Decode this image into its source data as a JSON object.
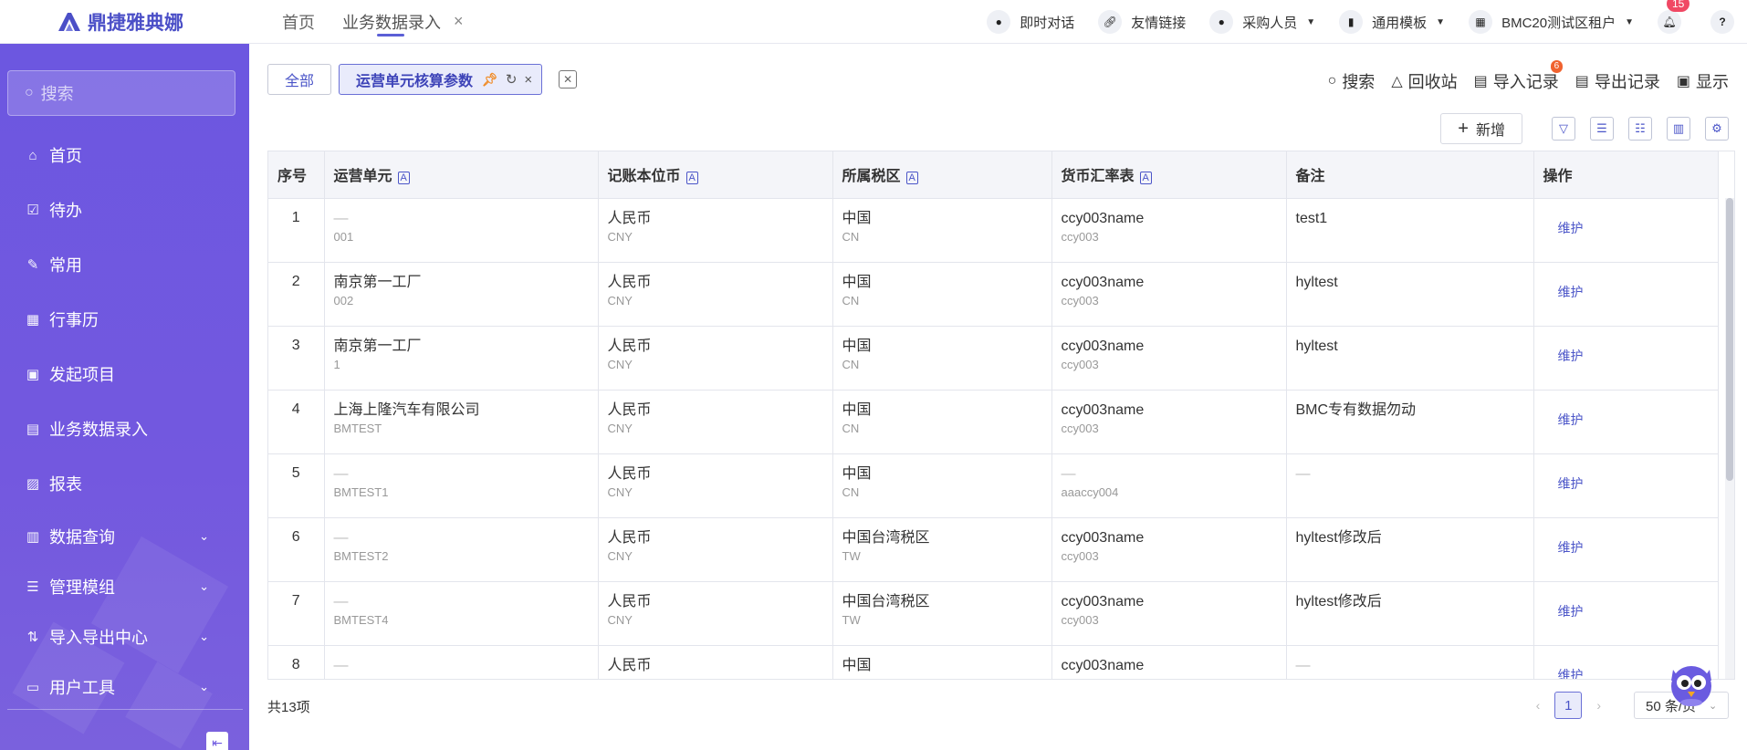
{
  "brand": {
    "name": "鼎捷雅典娜",
    "color": "#4b4fc7"
  },
  "header": {
    "tabs": [
      {
        "label": "首页"
      },
      {
        "label": "业务数据录入"
      }
    ],
    "items": {
      "chat": "即时对话",
      "links": "友情链接",
      "role": "采购人员",
      "template": "通用模板",
      "tenant": "BMC20测试区租户"
    },
    "notification_count": "15",
    "help_icon": "?"
  },
  "sidebar": {
    "search_placeholder": "搜索",
    "items": [
      {
        "label": "首页",
        "icon": "home-icon"
      },
      {
        "label": "待办",
        "icon": "todo-icon"
      },
      {
        "label": "常用",
        "icon": "pin-icon"
      },
      {
        "label": "行事历",
        "icon": "calendar-icon"
      },
      {
        "label": "发起项目",
        "icon": "project-icon"
      },
      {
        "label": "业务数据录入",
        "icon": "document-icon"
      },
      {
        "label": "报表",
        "icon": "report-icon"
      },
      {
        "label": "数据查询",
        "icon": "query-icon"
      },
      {
        "label": "管理模组",
        "icon": "module-icon"
      },
      {
        "label": "导入导出中心",
        "icon": "import-export-icon"
      },
      {
        "label": "用户工具",
        "icon": "tools-icon"
      }
    ]
  },
  "main": {
    "tab_all": "全部",
    "tab_current": "运营单元核算参数",
    "toolbar": {
      "search": "搜索",
      "recycle": "回收站",
      "import_log": "导入记录",
      "import_badge": "6",
      "export_log": "导出记录",
      "display": "显示"
    },
    "add_button": "新增",
    "table": {
      "columns": [
        "序号",
        "运营单元",
        "记账本位币",
        "所属税区",
        "货币汇率表",
        "备注",
        "操作"
      ],
      "op_label": "维护",
      "rows": [
        {
          "seq": "1",
          "unit": "—",
          "unit_code": "001",
          "currency": "人民币",
          "currency_code": "CNY",
          "tax": "中国",
          "tax_code": "CN",
          "rate": "ccy003name",
          "rate_code": "ccy003",
          "note": "test1"
        },
        {
          "seq": "2",
          "unit": "南京第一工厂",
          "unit_code": "002",
          "currency": "人民币",
          "currency_code": "CNY",
          "tax": "中国",
          "tax_code": "CN",
          "rate": "ccy003name",
          "rate_code": "ccy003",
          "note": "hyltest"
        },
        {
          "seq": "3",
          "unit": "南京第一工厂",
          "unit_code": "1",
          "currency": "人民币",
          "currency_code": "CNY",
          "tax": "中国",
          "tax_code": "CN",
          "rate": "ccy003name",
          "rate_code": "ccy003",
          "note": "hyltest"
        },
        {
          "seq": "4",
          "unit": "上海上隆汽车有限公司",
          "unit_code": "BMTEST",
          "currency": "人民币",
          "currency_code": "CNY",
          "tax": "中国",
          "tax_code": "CN",
          "rate": "ccy003name",
          "rate_code": "ccy003",
          "note": "BMC专有数据勿动"
        },
        {
          "seq": "5",
          "unit": "—",
          "unit_code": "BMTEST1",
          "currency": "人民币",
          "currency_code": "CNY",
          "tax": "中国",
          "tax_code": "CN",
          "rate": "—",
          "rate_code": "aaaccy004",
          "note": "—"
        },
        {
          "seq": "6",
          "unit": "—",
          "unit_code": "BMTEST2",
          "currency": "人民币",
          "currency_code": "CNY",
          "tax": "中国台湾税区",
          "tax_code": "TW",
          "rate": "ccy003name",
          "rate_code": "ccy003",
          "note": "hyltest修改后"
        },
        {
          "seq": "7",
          "unit": "—",
          "unit_code": "BMTEST4",
          "currency": "人民币",
          "currency_code": "CNY",
          "tax": "中国台湾税区",
          "tax_code": "TW",
          "rate": "ccy003name",
          "rate_code": "ccy003",
          "note": "hyltest修改后"
        },
        {
          "seq": "8",
          "unit": "—",
          "unit_code": "",
          "currency": "人民币",
          "currency_code": "",
          "tax": "中国",
          "tax_code": "",
          "rate": "ccy003name",
          "rate_code": "",
          "note": "—"
        }
      ]
    },
    "footer": {
      "total": "共13项",
      "page": "1",
      "page_size": "50 条/页"
    }
  },
  "colors": {
    "sidebar_top": "#6c57e0",
    "accent": "#4b55c8",
    "badge": "#f04864"
  }
}
